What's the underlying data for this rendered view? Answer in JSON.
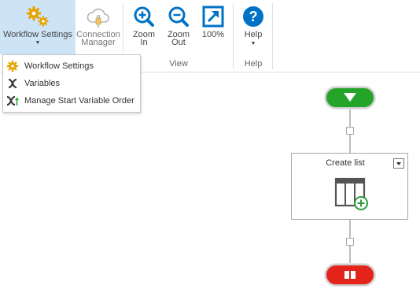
{
  "ribbon": {
    "workflow_settings_label": "Workflow Settings",
    "connection_manager_label_1": "Connection",
    "connection_manager_label_2": "Manager",
    "zoom_in_label_1": "Zoom",
    "zoom_in_label_2": "In",
    "zoom_out_label_1": "Zoom",
    "zoom_out_label_2": "Out",
    "zoom_100_label": "100%",
    "help_label": "Help",
    "group_view": "View",
    "group_help": "Help"
  },
  "menu": {
    "items": [
      {
        "label": "Workflow Settings",
        "icon": "gear-icon"
      },
      {
        "label": "Variables",
        "icon": "variable-x-icon"
      },
      {
        "label": "Manage Start Variable Order",
        "icon": "variable-order-icon"
      }
    ]
  },
  "canvas": {
    "action_title": "Create list",
    "action_icon": "create-list-icon"
  },
  "colors": {
    "accent": "#0072c6",
    "gear": "#e7a300",
    "start": "#24a52a",
    "stop": "#e3241b",
    "selected_bg": "#cde3f6"
  }
}
